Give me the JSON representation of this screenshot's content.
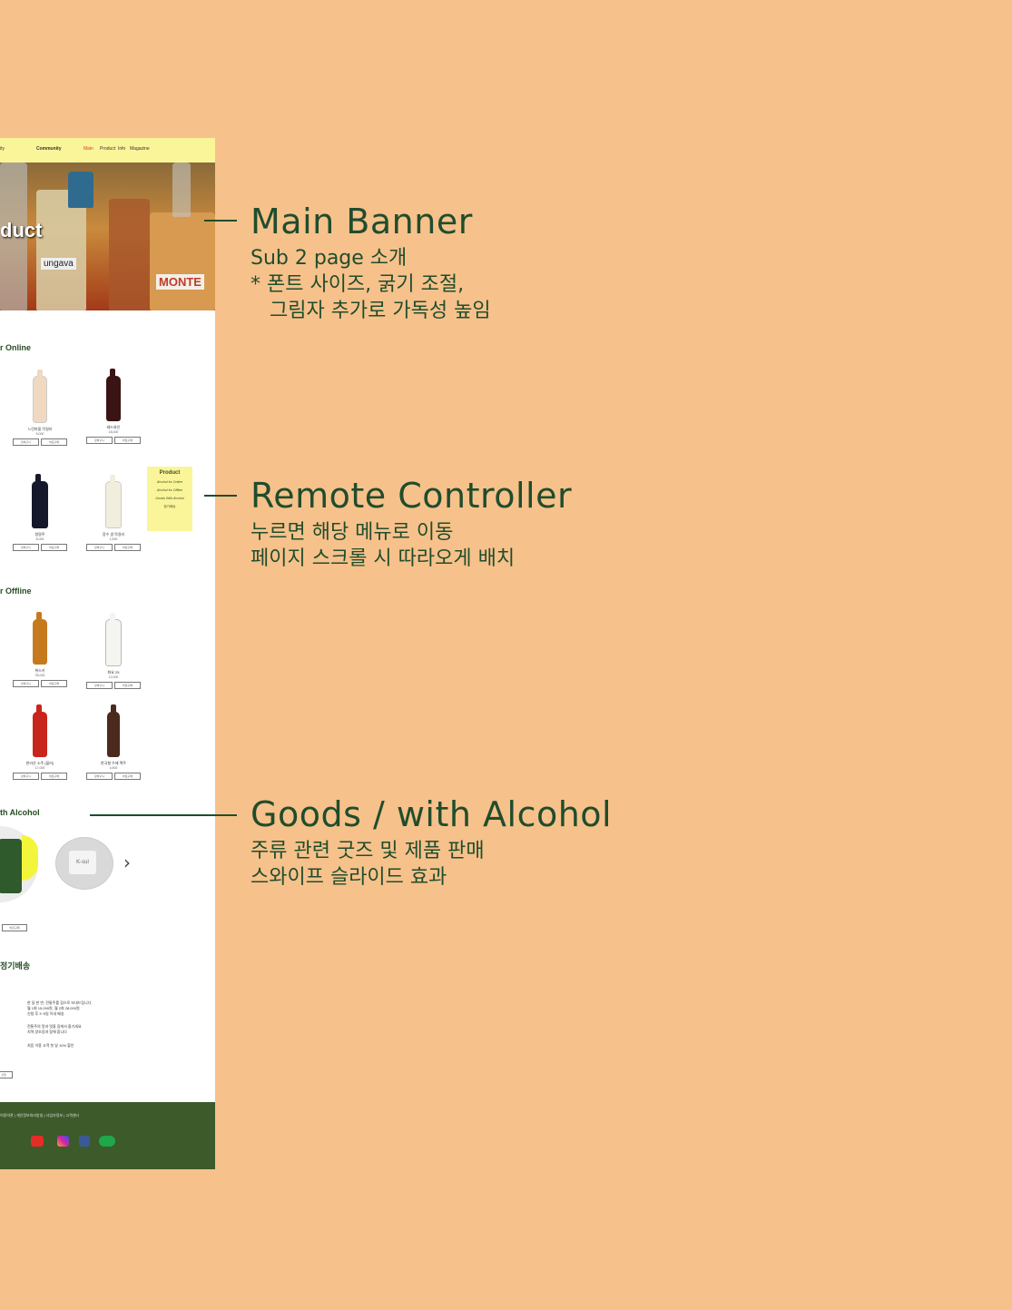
{
  "mockup": {
    "nav": {
      "left_item": "ity",
      "center_item": "Community",
      "menu": [
        "Main",
        "Product",
        "Info",
        "Magazine"
      ]
    },
    "banner": {
      "title": "duct",
      "label_1": "ungava",
      "label_2": "MONTE"
    },
    "sections": {
      "online_title": "r Online",
      "offline_title": "r Offline",
      "goods_title": "th Alcohol",
      "subscription_title": "정기배송"
    },
    "online_products": [
      {
        "name": "느린마을 막걸리",
        "price": "5,000"
      },
      {
        "name": "레드와인",
        "price": "18,000"
      },
      {
        "name": "청명주",
        "price": "8,000"
      },
      {
        "name": "장수 생 막걸리",
        "price": "1,500"
      }
    ],
    "offline_products": [
      {
        "name": "위스키",
        "price": "35,000"
      },
      {
        "name": "화요 25",
        "price": "12,000"
      },
      {
        "name": "한라산 소주 (플러)",
        "price": "17,000"
      },
      {
        "name": "한국형 수제 맥주",
        "price": "4,500"
      }
    ],
    "product_buttons": {
      "cart": "장바구니",
      "buy": "바로구매"
    },
    "remote_controller": {
      "title": "Product",
      "items": [
        "Alcohol for Online",
        "Alcohol for Offline",
        "Goods With Alcohol",
        "정기배송"
      ]
    },
    "goods": {
      "mug_label": "K-sul",
      "next_arrow": "›",
      "button": "바로구매"
    },
    "subscription": {
      "lines": [
        "한 달 한 번, 전통주를 집으로 보내드립니다.",
        "월 1회 15,000원, 월 2회 28,000원",
        "신청 후 3~5일 이내 배송",
        "",
        "전통주의 맛과 멋을 집에서 즐기세요",
        "지역 양조장과 함께 합니다",
        "",
        "처음 이용 고객 첫 달 10% 할인"
      ],
      "button": "신청"
    },
    "footer": {
      "links": "이용약관  |  개인정보처리방침  |  사업자정보  |  고객센터"
    }
  },
  "annotations": [
    {
      "title": "Main Banner",
      "description": "Sub 2 page 소개\n* 폰트 사이즈, 굵기 조절,\n   그림자 추가로 가독성 높임"
    },
    {
      "title": "Remote Controller",
      "description": "누르면 해당 메뉴로 이동\n페이지 스크롤 시 따라오게 배치"
    },
    {
      "title": "Goods / with Alcohol",
      "description": "주류 관련 굿즈 및 제품 판매\n스와이프 슬라이드 효과"
    }
  ],
  "colors": {
    "background": "#f7c18b",
    "annotation_text": "#1f4d2c",
    "nav_yellow": "#fbf59a",
    "footer_green": "#3d5a2b"
  }
}
